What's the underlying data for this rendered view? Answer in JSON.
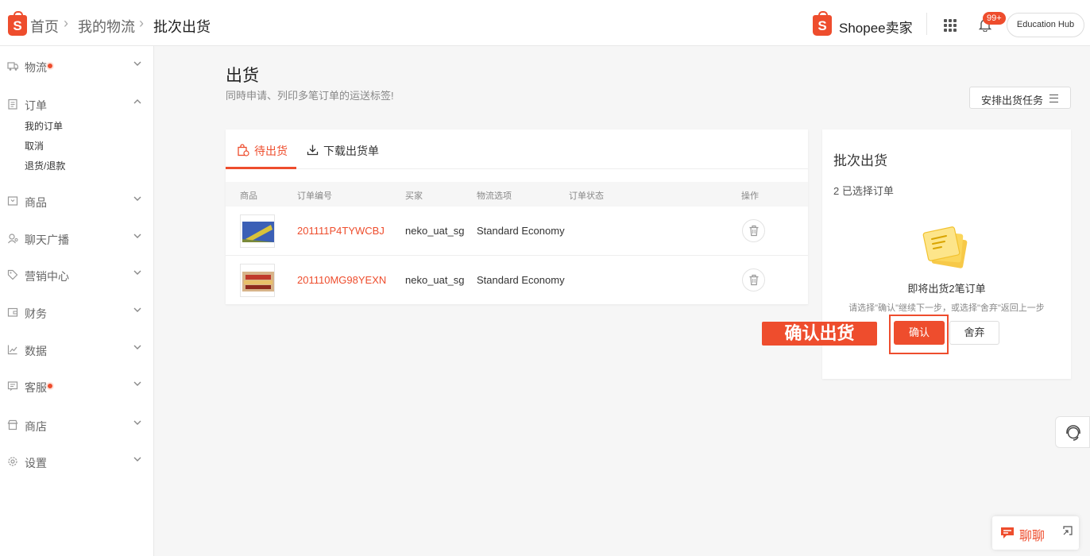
{
  "header": {
    "breadcrumb": [
      "首页",
      "我的物流",
      "批次出货"
    ],
    "brand": "Shopee卖家",
    "logo_letter": "S",
    "notification_badge": "99+",
    "education_hub": "Education Hub"
  },
  "sidebar": {
    "items": [
      {
        "label": "物流",
        "icon": "truck-icon",
        "dot": true
      },
      {
        "label": "订单",
        "icon": "clipboard-icon",
        "dot": false,
        "expanded": true
      },
      {
        "label": "商品",
        "icon": "box-icon",
        "dot": false
      },
      {
        "label": "聊天广播",
        "icon": "megaphone-icon",
        "dot": false
      },
      {
        "label": "营销中心",
        "icon": "tag-icon",
        "dot": false
      },
      {
        "label": "财务",
        "icon": "wallet-icon",
        "dot": false
      },
      {
        "label": "数据",
        "icon": "chart-icon",
        "dot": false
      },
      {
        "label": "客服",
        "icon": "message-icon",
        "dot": true
      },
      {
        "label": "商店",
        "icon": "shop-icon",
        "dot": false
      },
      {
        "label": "设置",
        "icon": "gear-icon",
        "dot": false
      }
    ],
    "order_sub": [
      "我的订单",
      "取消",
      "退货/退款"
    ]
  },
  "main": {
    "title": "出货",
    "subtitle": "同時申请、列印多笔订单的运送标签!",
    "arrange_button": "安排出货任务"
  },
  "tabs": [
    {
      "label": "待出货",
      "active": true
    },
    {
      "label": "下载出货单",
      "active": false
    }
  ],
  "table": {
    "columns": [
      "商品",
      "订单编号",
      "买家",
      "物流选项",
      "订单状态",
      "操作"
    ],
    "rows": [
      {
        "order_id": "201111P4TYWCBJ",
        "buyer": "neko_uat_sg",
        "shipping": "Standard Economy",
        "status": ""
      },
      {
        "order_id": "201110MG98YEXN",
        "buyer": "neko_uat_sg",
        "shipping": "Standard Economy",
        "status": ""
      }
    ]
  },
  "batch": {
    "title": "批次出货",
    "selected": "2 已选择订单",
    "soon": "即将出货2笔订单",
    "hint": "请选择\"确认\"继续下一步，或选择\"舍弃\"返回上一步",
    "confirm": "确认",
    "discard": "舍弃"
  },
  "callout": "确认出货",
  "chat": "聊聊",
  "colors": {
    "accent": "#ee4d2d"
  }
}
